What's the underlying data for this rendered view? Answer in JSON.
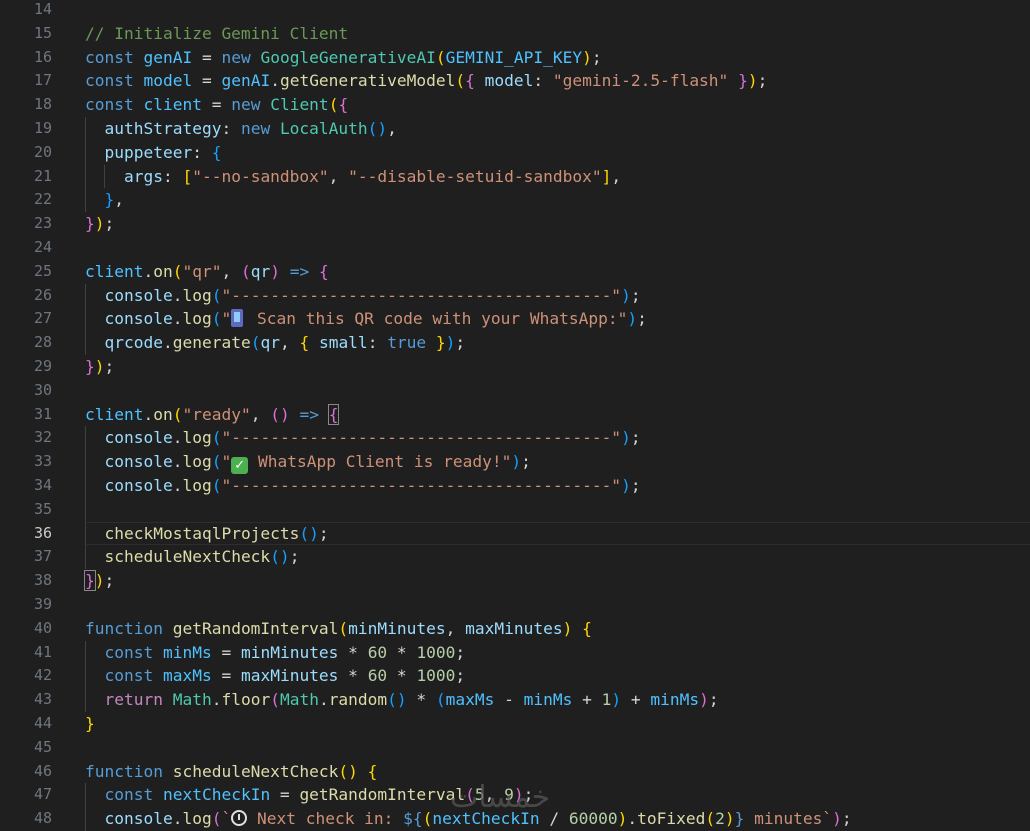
{
  "editor": {
    "current_line": 36,
    "lines": [
      {
        "n": "14",
        "t": []
      },
      {
        "n": "15",
        "t": [
          [
            "// Initialize Gemini Client",
            "comment"
          ]
        ]
      },
      {
        "n": "16",
        "t": [
          [
            "const ",
            "kw"
          ],
          [
            "genAI",
            "const"
          ],
          [
            " = ",
            "op"
          ],
          [
            "new ",
            "kw"
          ],
          [
            "GoogleGenerativeAI",
            "cls"
          ],
          [
            "(",
            "b1"
          ],
          [
            "GEMINI_API_KEY",
            "const"
          ],
          [
            ")",
            "b1"
          ],
          [
            ";",
            "op"
          ]
        ]
      },
      {
        "n": "17",
        "t": [
          [
            "const ",
            "kw"
          ],
          [
            "model",
            "const"
          ],
          [
            " = ",
            "op"
          ],
          [
            "genAI",
            "const"
          ],
          [
            ".",
            "op"
          ],
          [
            "getGenerativeModel",
            "fn"
          ],
          [
            "(",
            "b1"
          ],
          [
            "{",
            "b2"
          ],
          [
            " model",
            "var"
          ],
          [
            ": ",
            "op"
          ],
          [
            "\"gemini-2.5-flash\"",
            "str"
          ],
          [
            " ",
            "op"
          ],
          [
            "}",
            "b2"
          ],
          [
            ")",
            "b1"
          ],
          [
            ";",
            "op"
          ]
        ]
      },
      {
        "n": "18",
        "t": [
          [
            "const ",
            "kw"
          ],
          [
            "client",
            "const"
          ],
          [
            " = ",
            "op"
          ],
          [
            "new ",
            "kw"
          ],
          [
            "Client",
            "cls"
          ],
          [
            "(",
            "b1"
          ],
          [
            "{",
            "b2"
          ]
        ]
      },
      {
        "n": "19",
        "t": [
          [
            "  ",
            "op"
          ],
          [
            "authStrategy",
            "var"
          ],
          [
            ": ",
            "op"
          ],
          [
            "new ",
            "kw"
          ],
          [
            "LocalAuth",
            "cls"
          ],
          [
            "()",
            "b3"
          ],
          [
            ",",
            "op"
          ]
        ]
      },
      {
        "n": "20",
        "t": [
          [
            "  ",
            "op"
          ],
          [
            "puppeteer",
            "var"
          ],
          [
            ": ",
            "op"
          ],
          [
            "{",
            "b3"
          ]
        ]
      },
      {
        "n": "21",
        "t": [
          [
            "    ",
            "op"
          ],
          [
            "args",
            "var"
          ],
          [
            ": ",
            "op"
          ],
          [
            "[",
            "b1"
          ],
          [
            "\"--no-sandbox\"",
            "str"
          ],
          [
            ", ",
            "op"
          ],
          [
            "\"--disable-setuid-sandbox\"",
            "str"
          ],
          [
            "]",
            "b1"
          ],
          [
            ",",
            "op"
          ]
        ]
      },
      {
        "n": "22",
        "t": [
          [
            "  ",
            "op"
          ],
          [
            "}",
            "b3"
          ],
          [
            ",",
            "op"
          ]
        ]
      },
      {
        "n": "23",
        "t": [
          [
            "}",
            "b2"
          ],
          [
            ")",
            "b1"
          ],
          [
            ";",
            "op"
          ]
        ]
      },
      {
        "n": "24",
        "t": []
      },
      {
        "n": "25",
        "t": [
          [
            "client",
            "const"
          ],
          [
            ".",
            "op"
          ],
          [
            "on",
            "fn"
          ],
          [
            "(",
            "b1"
          ],
          [
            "\"qr\"",
            "str"
          ],
          [
            ", ",
            "op"
          ],
          [
            "(",
            "b2"
          ],
          [
            "qr",
            "var"
          ],
          [
            ")",
            "b2"
          ],
          [
            " => ",
            "kw"
          ],
          [
            "{",
            "b2"
          ]
        ]
      },
      {
        "n": "26",
        "t": [
          [
            "  ",
            "op"
          ],
          [
            "console",
            "var"
          ],
          [
            ".",
            "op"
          ],
          [
            "log",
            "fn"
          ],
          [
            "(",
            "b3"
          ],
          [
            "\"---------------------------------------\"",
            "str"
          ],
          [
            ")",
            "b3"
          ],
          [
            ";",
            "op"
          ]
        ]
      },
      {
        "n": "27",
        "t": [
          [
            "  ",
            "op"
          ],
          [
            "console",
            "var"
          ],
          [
            ".",
            "op"
          ],
          [
            "log",
            "fn"
          ],
          [
            "(",
            "b3"
          ],
          [
            "\"",
            "str"
          ],
          [
            "PHONE",
            "emoji-phone"
          ],
          [
            " Scan this QR code with your WhatsApp:\"",
            "str"
          ],
          [
            ")",
            "b3"
          ],
          [
            ";",
            "op"
          ]
        ]
      },
      {
        "n": "28",
        "t": [
          [
            "  ",
            "op"
          ],
          [
            "qrcode",
            "var"
          ],
          [
            ".",
            "op"
          ],
          [
            "generate",
            "fn"
          ],
          [
            "(",
            "b3"
          ],
          [
            "qr",
            "var"
          ],
          [
            ", ",
            "op"
          ],
          [
            "{",
            "b1"
          ],
          [
            " small",
            "var"
          ],
          [
            ": ",
            "op"
          ],
          [
            "true",
            "kw"
          ],
          [
            " ",
            "op"
          ],
          [
            "}",
            "b1"
          ],
          [
            ")",
            "b3"
          ],
          [
            ";",
            "op"
          ]
        ]
      },
      {
        "n": "29",
        "t": [
          [
            "}",
            "b2"
          ],
          [
            ")",
            "b1"
          ],
          [
            ";",
            "op"
          ]
        ]
      },
      {
        "n": "30",
        "t": []
      },
      {
        "n": "31",
        "t": [
          [
            "client",
            "const"
          ],
          [
            ".",
            "op"
          ],
          [
            "on",
            "fn"
          ],
          [
            "(",
            "b1"
          ],
          [
            "\"ready\"",
            "str"
          ],
          [
            ", ",
            "op"
          ],
          [
            "()",
            "b2"
          ],
          [
            " => ",
            "kw"
          ],
          [
            "{",
            "b2m"
          ]
        ]
      },
      {
        "n": "32",
        "t": [
          [
            "  ",
            "op"
          ],
          [
            "console",
            "var"
          ],
          [
            ".",
            "op"
          ],
          [
            "log",
            "fn"
          ],
          [
            "(",
            "b3"
          ],
          [
            "\"---------------------------------------\"",
            "str"
          ],
          [
            ")",
            "b3"
          ],
          [
            ";",
            "op"
          ]
        ]
      },
      {
        "n": "33",
        "t": [
          [
            "  ",
            "op"
          ],
          [
            "console",
            "var"
          ],
          [
            ".",
            "op"
          ],
          [
            "log",
            "fn"
          ],
          [
            "(",
            "b3"
          ],
          [
            "\"",
            "str"
          ],
          [
            "CHECK",
            "emoji-check"
          ],
          [
            " WhatsApp Client is ready!\"",
            "str"
          ],
          [
            ")",
            "b3"
          ],
          [
            ";",
            "op"
          ]
        ]
      },
      {
        "n": "34",
        "t": [
          [
            "  ",
            "op"
          ],
          [
            "console",
            "var"
          ],
          [
            ".",
            "op"
          ],
          [
            "log",
            "fn"
          ],
          [
            "(",
            "b3"
          ],
          [
            "\"---------------------------------------\"",
            "str"
          ],
          [
            ")",
            "b3"
          ],
          [
            ";",
            "op"
          ]
        ]
      },
      {
        "n": "35",
        "t": []
      },
      {
        "n": "36",
        "t": [
          [
            "  ",
            "op"
          ],
          [
            "checkMostaqlProjects",
            "fn"
          ],
          [
            "()",
            "b3"
          ],
          [
            ";",
            "op"
          ]
        ]
      },
      {
        "n": "37",
        "t": [
          [
            "  ",
            "op"
          ],
          [
            "scheduleNextCheck",
            "fn"
          ],
          [
            "()",
            "b3"
          ],
          [
            ";",
            "op"
          ]
        ]
      },
      {
        "n": "38",
        "t": [
          [
            "}",
            "b2m"
          ],
          [
            ")",
            "b1"
          ],
          [
            ";",
            "op"
          ]
        ]
      },
      {
        "n": "39",
        "t": []
      },
      {
        "n": "40",
        "t": [
          [
            "function ",
            "kw"
          ],
          [
            "getRandomInterval",
            "fn"
          ],
          [
            "(",
            "b1"
          ],
          [
            "minMinutes",
            "var"
          ],
          [
            ", ",
            "op"
          ],
          [
            "maxMinutes",
            "var"
          ],
          [
            ")",
            "b1"
          ],
          [
            " ",
            "op"
          ],
          [
            "{",
            "b1"
          ]
        ]
      },
      {
        "n": "41",
        "t": [
          [
            "  ",
            "op"
          ],
          [
            "const ",
            "kw"
          ],
          [
            "minMs",
            "const"
          ],
          [
            " = ",
            "op"
          ],
          [
            "minMinutes",
            "var"
          ],
          [
            " * ",
            "op"
          ],
          [
            "60",
            "num"
          ],
          [
            " * ",
            "op"
          ],
          [
            "1000",
            "num"
          ],
          [
            ";",
            "op"
          ]
        ]
      },
      {
        "n": "42",
        "t": [
          [
            "  ",
            "op"
          ],
          [
            "const ",
            "kw"
          ],
          [
            "maxMs",
            "const"
          ],
          [
            " = ",
            "op"
          ],
          [
            "maxMinutes",
            "var"
          ],
          [
            " * ",
            "op"
          ],
          [
            "60",
            "num"
          ],
          [
            " * ",
            "op"
          ],
          [
            "1000",
            "num"
          ],
          [
            ";",
            "op"
          ]
        ]
      },
      {
        "n": "43",
        "t": [
          [
            "  ",
            "op"
          ],
          [
            "return ",
            "ctrl"
          ],
          [
            "Math",
            "cls"
          ],
          [
            ".",
            "op"
          ],
          [
            "floor",
            "fn"
          ],
          [
            "(",
            "b2"
          ],
          [
            "Math",
            "cls"
          ],
          [
            ".",
            "op"
          ],
          [
            "random",
            "fn"
          ],
          [
            "()",
            "b3"
          ],
          [
            " * ",
            "op"
          ],
          [
            "(",
            "b3"
          ],
          [
            "maxMs",
            "const"
          ],
          [
            " - ",
            "op"
          ],
          [
            "minMs",
            "const"
          ],
          [
            " + ",
            "op"
          ],
          [
            "1",
            "num"
          ],
          [
            ")",
            "b3"
          ],
          [
            " + ",
            "op"
          ],
          [
            "minMs",
            "const"
          ],
          [
            ")",
            "b2"
          ],
          [
            ";",
            "op"
          ]
        ]
      },
      {
        "n": "44",
        "t": [
          [
            "}",
            "b1"
          ]
        ]
      },
      {
        "n": "45",
        "t": []
      },
      {
        "n": "46",
        "t": [
          [
            "function ",
            "kw"
          ],
          [
            "scheduleNextCheck",
            "fn"
          ],
          [
            "()",
            "b1"
          ],
          [
            " ",
            "op"
          ],
          [
            "{",
            "b1"
          ]
        ]
      },
      {
        "n": "47",
        "t": [
          [
            "  ",
            "op"
          ],
          [
            "const ",
            "kw"
          ],
          [
            "nextCheckIn",
            "const"
          ],
          [
            " = ",
            "op"
          ],
          [
            "getRandomInterval",
            "fn"
          ],
          [
            "(",
            "b2"
          ],
          [
            "5",
            "num"
          ],
          [
            ", ",
            "op"
          ],
          [
            "9",
            "num"
          ],
          [
            ")",
            "b2"
          ],
          [
            ";",
            "op"
          ]
        ]
      },
      {
        "n": "48",
        "t": [
          [
            "  ",
            "op"
          ],
          [
            "console",
            "var"
          ],
          [
            ".",
            "op"
          ],
          [
            "log",
            "fn"
          ],
          [
            "(",
            "b2"
          ],
          [
            "`",
            "str"
          ],
          [
            "CLOCK",
            "emoji-clock"
          ],
          [
            " Next check in: ",
            "str"
          ],
          [
            "${",
            "tpl"
          ],
          [
            "(",
            "b1"
          ],
          [
            "nextCheckIn",
            "const"
          ],
          [
            " / ",
            "op"
          ],
          [
            "60000",
            "num"
          ],
          [
            ")",
            "b1"
          ],
          [
            ".",
            "op"
          ],
          [
            "toFixed",
            "fn"
          ],
          [
            "(",
            "b1"
          ],
          [
            "2",
            "num"
          ],
          [
            ")",
            "b1"
          ],
          [
            "}",
            "tpl"
          ],
          [
            " minutes`",
            "str"
          ],
          [
            ")",
            "b2"
          ],
          [
            ";",
            "op"
          ]
        ]
      }
    ]
  },
  "watermark": "خمسات",
  "colors": {
    "background": "#1f1f1f",
    "line_number": "#6e7681",
    "keyword": "#569cd6",
    "control": "#c586c0",
    "variable": "#9cdcfe",
    "constant": "#4fc1ff",
    "function": "#dcdcaa",
    "class": "#4ec9b0",
    "string": "#ce9178",
    "number": "#b5cea8",
    "comment": "#6a9955"
  }
}
